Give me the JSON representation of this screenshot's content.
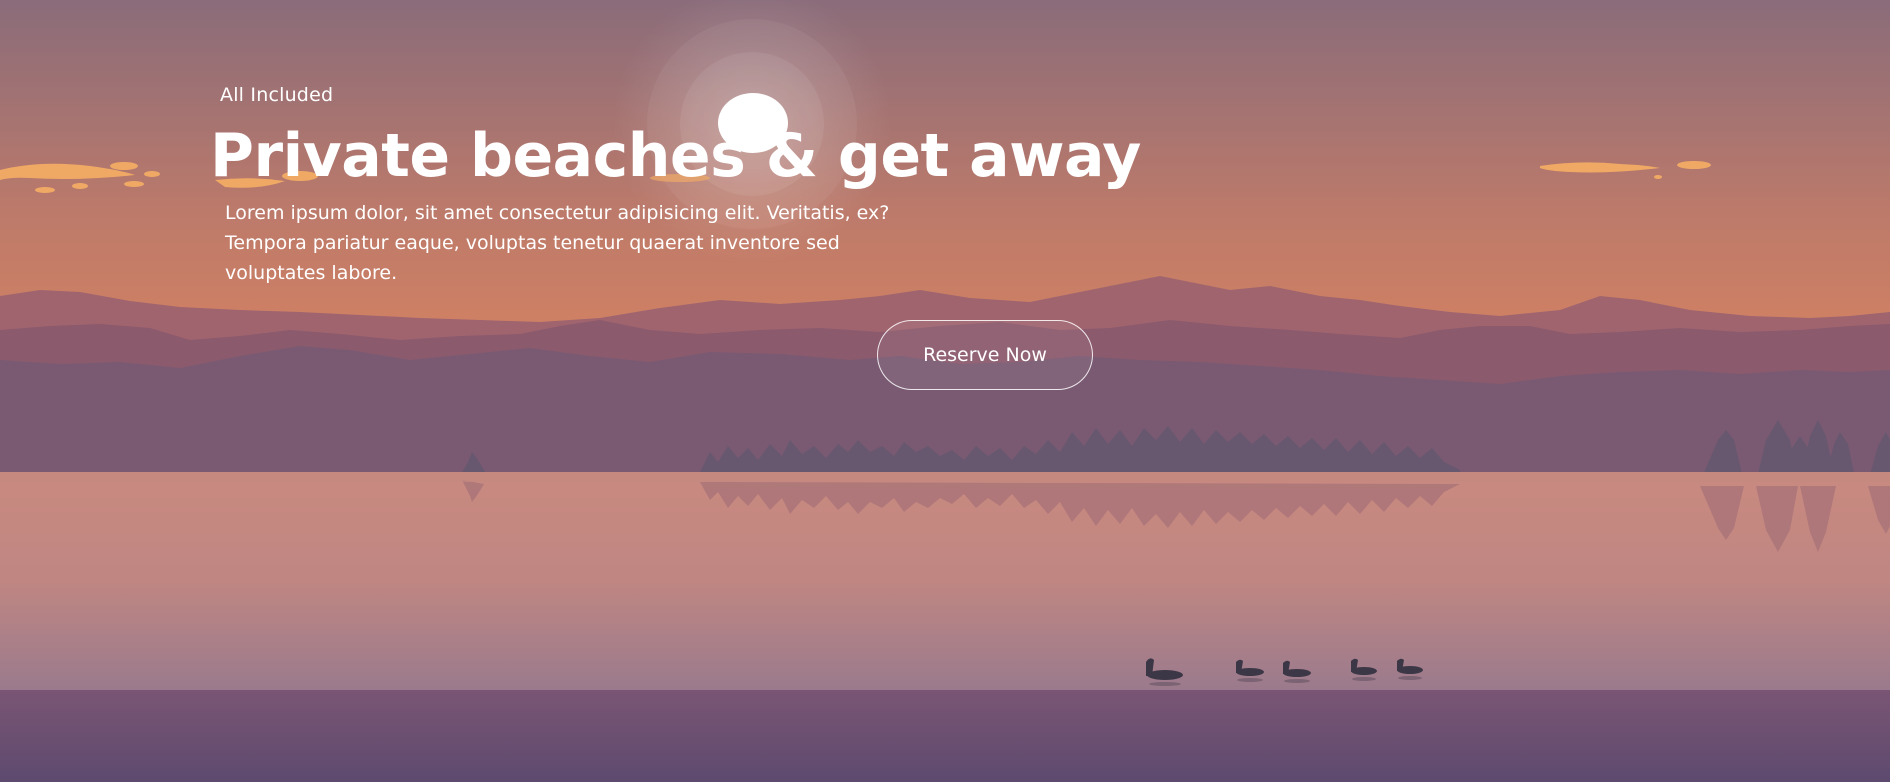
{
  "hero": {
    "eyebrow": "All Included",
    "title": "Private beaches & get away",
    "body": "Lorem ipsum dolor, sit amet consectetur adipisicing elit. Veritatis, ex? Tempora pariatur eaque, voluptas tenetur quaerat inventore sed voluptates labore.",
    "cta_label": "Reserve Now"
  },
  "colors": {
    "sky_top": "#8a6c7a",
    "sky_bottom": "#e7895d",
    "sun": "#ffffff",
    "cloud": "#f0a965",
    "mountain_far": "#a0646f",
    "mountain_mid": "#8c5a6d",
    "mountain_near": "#7a5a72",
    "treeline": "#675870",
    "lake_top": "#c88a80",
    "lake_bottom": "#9c7a8c",
    "shore_top": "#7a5574",
    "shore_bottom": "#5c4a6e",
    "duck": "#3c3746"
  }
}
